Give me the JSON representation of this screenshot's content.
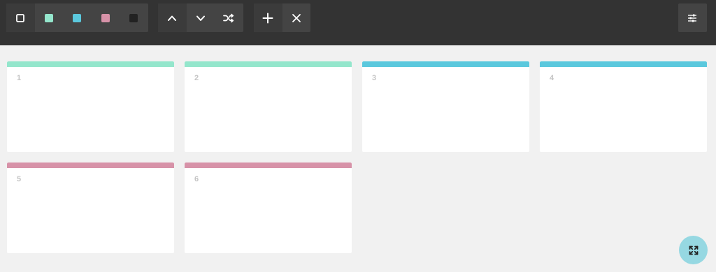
{
  "toolbar": {
    "icons": {
      "select": "square-outline-icon",
      "up": "chevron-up-icon",
      "down": "chevron-down-icon",
      "shuffle": "shuffle-icon",
      "add": "plus-icon",
      "remove": "close-icon",
      "settings": "sliders-icon"
    },
    "swatches": [
      {
        "name": "mint",
        "color": "#94e6cc"
      },
      {
        "name": "cyan",
        "color": "#5bc8dd"
      },
      {
        "name": "pink",
        "color": "#d792a8"
      },
      {
        "name": "dark",
        "color": "#222222"
      }
    ]
  },
  "cards": [
    {
      "label": "1",
      "color": "#94e6cc"
    },
    {
      "label": "2",
      "color": "#94e6cc"
    },
    {
      "label": "3",
      "color": "#5bc8dd"
    },
    {
      "label": "4",
      "color": "#5bc8dd"
    },
    {
      "label": "5",
      "color": "#d792a8"
    },
    {
      "label": "6",
      "color": "#d792a8"
    }
  ],
  "fab": {
    "icon": "expand-arrows-icon",
    "color": "#96d8e2"
  }
}
